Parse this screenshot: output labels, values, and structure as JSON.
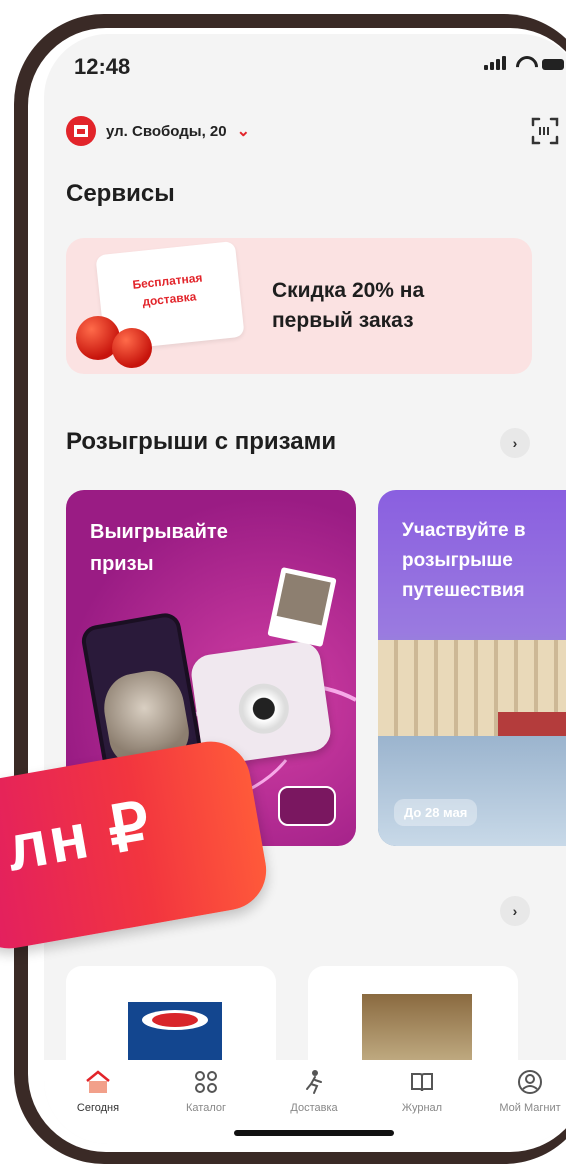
{
  "status_bar": {
    "time": "12:48"
  },
  "header": {
    "address": "ул. Свободы, 20"
  },
  "services": {
    "title": "Сервисы",
    "promo_ticket": "Бесплатная доставка",
    "promo_text": "Скидка 20% на первый заказ"
  },
  "raffles": {
    "title": "Розыгрыши с призами",
    "cards": [
      {
        "title": "Выигрывайте призы"
      },
      {
        "title": "Участвуйте в розыгрыше путешествия",
        "date_tag": "До 28 мая"
      }
    ]
  },
  "ribbon": {
    "text": "лн ₽"
  },
  "products": {
    "brand": "Barilla"
  },
  "tabbar": {
    "items": [
      {
        "label": "Сегодня",
        "icon": "home-icon"
      },
      {
        "label": "Каталог",
        "icon": "catalog-icon"
      },
      {
        "label": "Доставка",
        "icon": "delivery-icon"
      },
      {
        "label": "Журнал",
        "icon": "journal-icon"
      },
      {
        "label": "Мой Магнит",
        "icon": "profile-icon"
      }
    ]
  },
  "colors": {
    "brand_red": "#e2242a",
    "card_purple": "#9a1c84",
    "promo_pink": "#fbe2e2"
  }
}
